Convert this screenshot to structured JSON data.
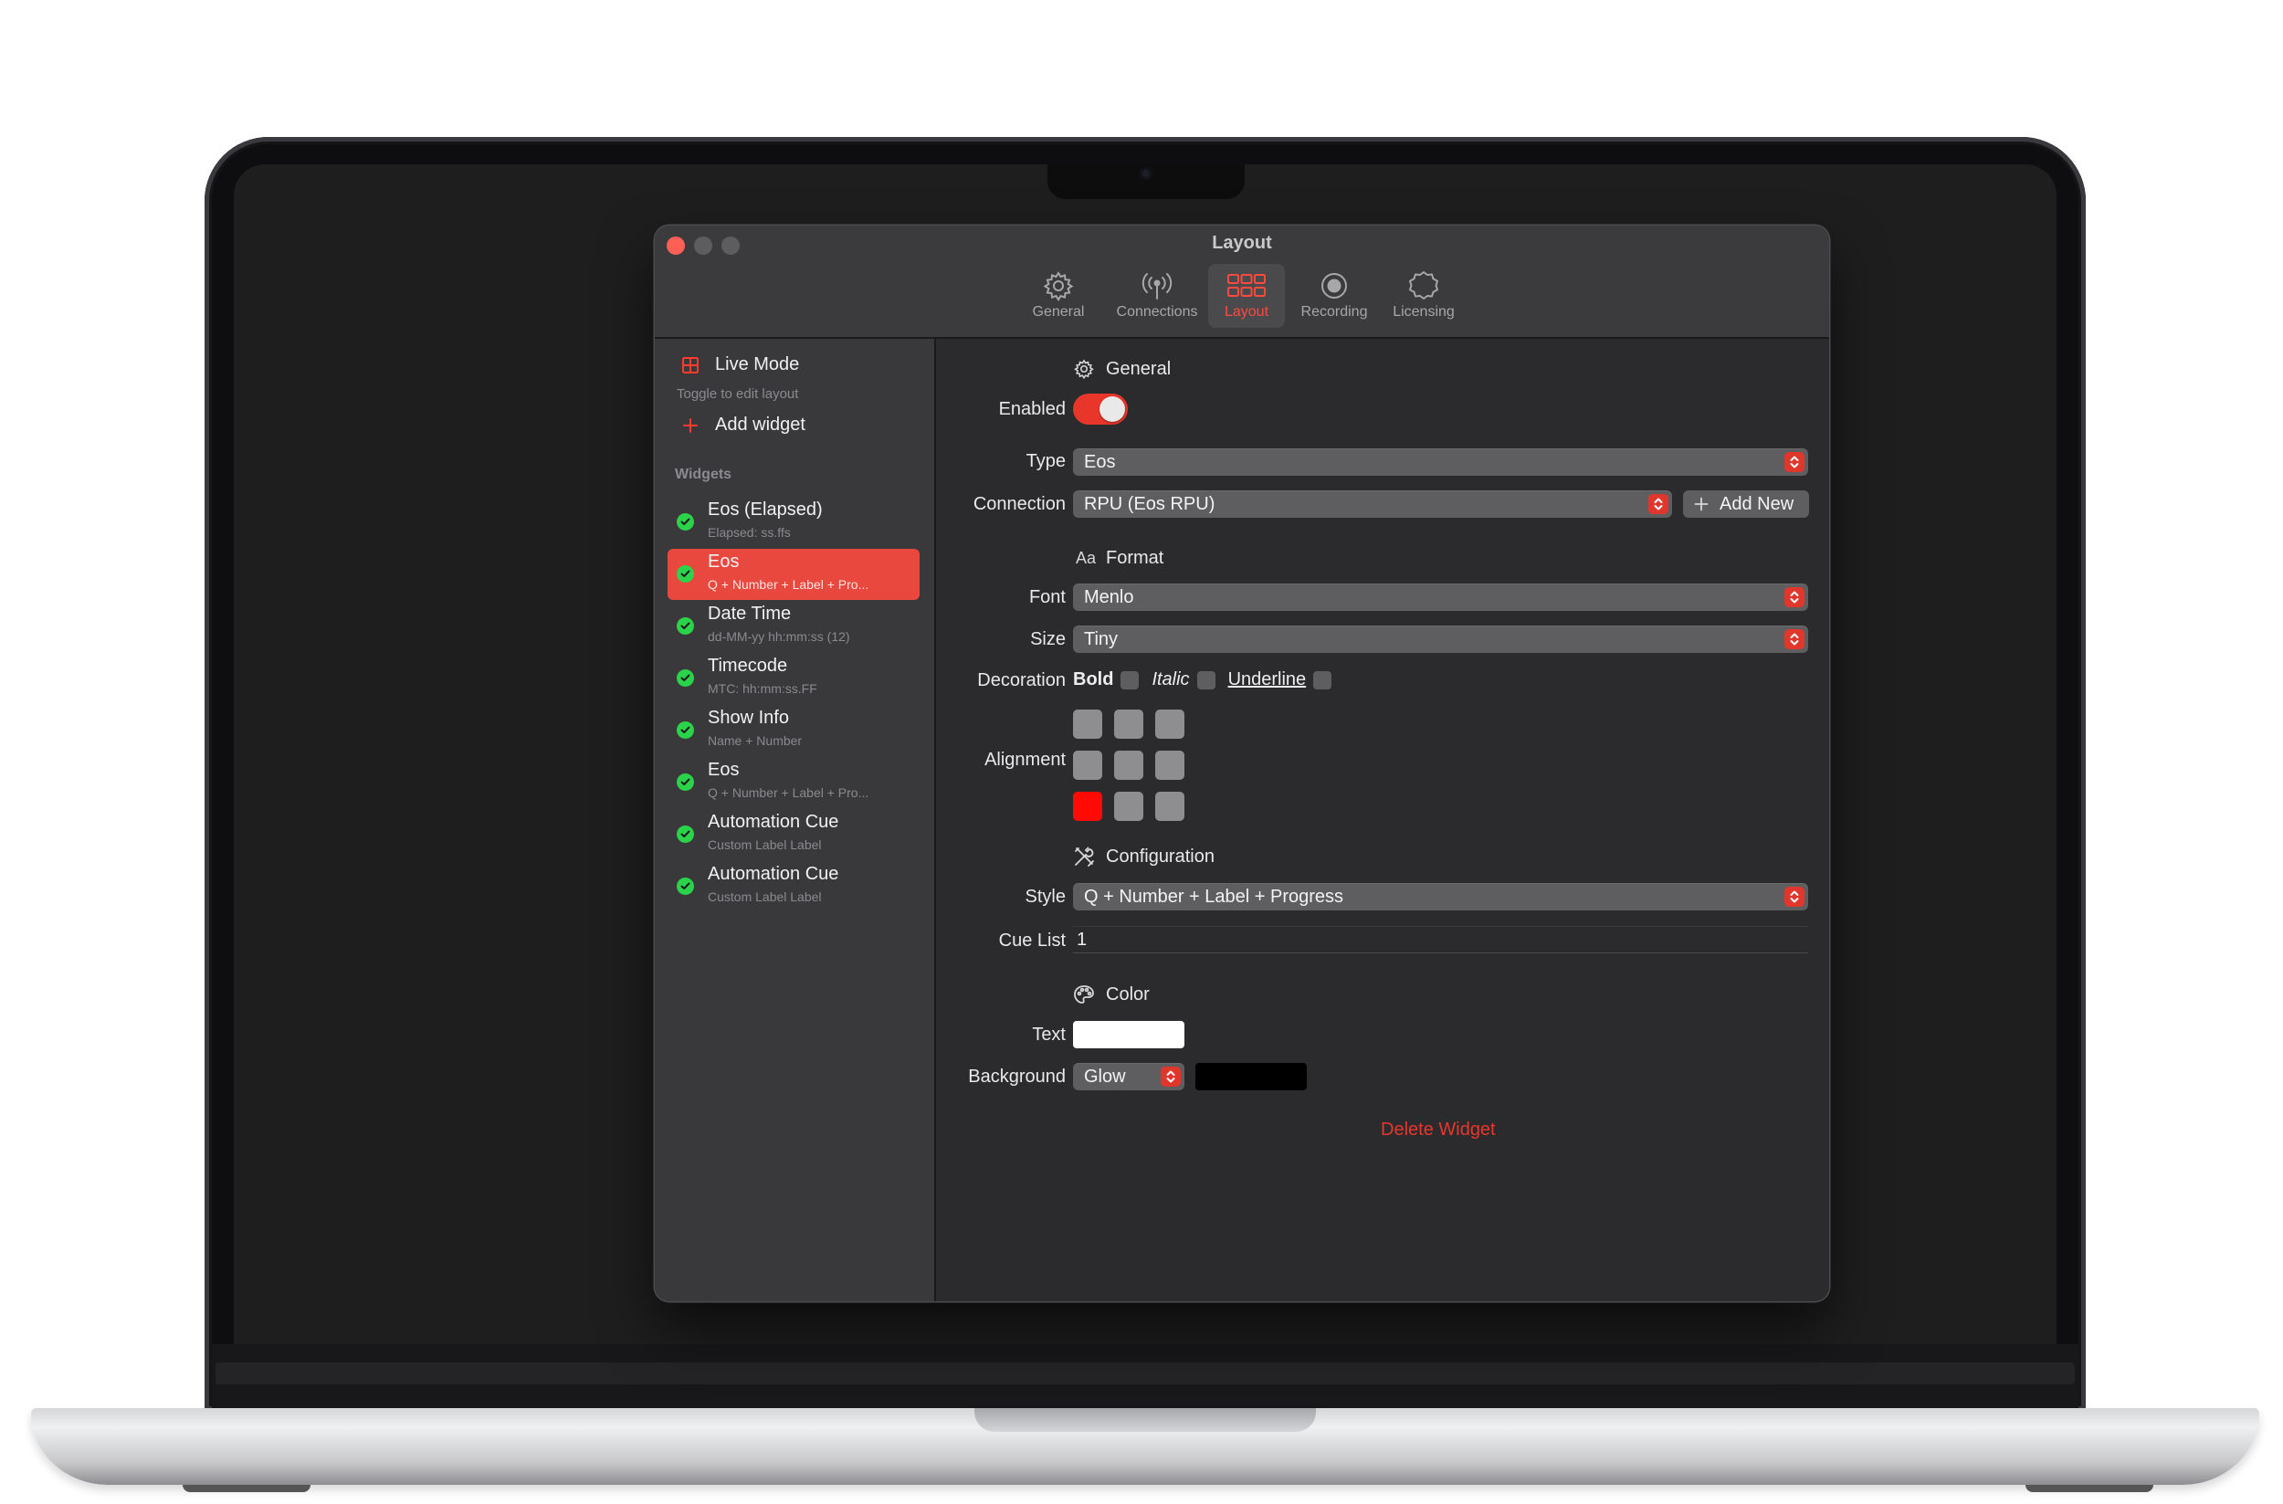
{
  "window": {
    "title": "Layout"
  },
  "toolbar": {
    "tabs": [
      {
        "label": "General",
        "icon": "gear-icon"
      },
      {
        "label": "Connections",
        "icon": "antenna-icon"
      },
      {
        "label": "Layout",
        "icon": "grid-icon",
        "active": true
      },
      {
        "label": "Recording",
        "icon": "record-icon"
      },
      {
        "label": "Licensing",
        "icon": "badge-icon"
      }
    ]
  },
  "sidebar": {
    "live_mode_label": "Live Mode",
    "live_mode_caption": "Toggle to edit layout",
    "add_widget_label": "Add widget",
    "widgets_heading": "Widgets",
    "widgets": [
      {
        "title": "Eos (Elapsed)",
        "subtitle": "Elapsed: ss.ffs"
      },
      {
        "title": "Eos",
        "subtitle": "Q + Number + Label + Pro...",
        "selected": true
      },
      {
        "title": "Date Time",
        "subtitle": "dd-MM-yy hh:mm:ss (12)"
      },
      {
        "title": "Timecode",
        "subtitle": "MTC: hh:mm:ss.FF"
      },
      {
        "title": "Show Info",
        "subtitle": "Name + Number"
      },
      {
        "title": "Eos",
        "subtitle": "Q + Number + Label + Pro..."
      },
      {
        "title": "Automation Cue",
        "subtitle": "Custom Label Label"
      },
      {
        "title": "Automation Cue",
        "subtitle": "Custom Label Label"
      }
    ]
  },
  "form": {
    "general_heading": "General",
    "enabled_label": "Enabled",
    "enabled": true,
    "type_label": "Type",
    "type_value": "Eos",
    "connection_label": "Connection",
    "connection_value": "RPU (Eos RPU)",
    "add_new_label": "Add New",
    "format_icon": "Aa",
    "format_heading": "Format",
    "font_label": "Font",
    "font_value": "Menlo",
    "size_label": "Size",
    "size_value": "Tiny",
    "decoration_label": "Decoration",
    "bold_label": "Bold",
    "italic_label": "Italic",
    "underline_label": "Underline",
    "alignment_label": "Alignment",
    "alignment_selected": "bottom-left",
    "configuration_heading": "Configuration",
    "style_label": "Style",
    "style_value": "Q + Number + Label + Progress",
    "cue_list_label": "Cue List",
    "cue_list_value": "1",
    "color_heading": "Color",
    "text_label": "Text",
    "text_color": "#ffffff",
    "background_label": "Background",
    "background_mode": "Glow",
    "background_color": "#000000",
    "delete_label": "Delete Widget"
  },
  "colors": {
    "accent": "#e8362b",
    "selection": "#e8483d",
    "status_ok": "#2bd34a"
  }
}
